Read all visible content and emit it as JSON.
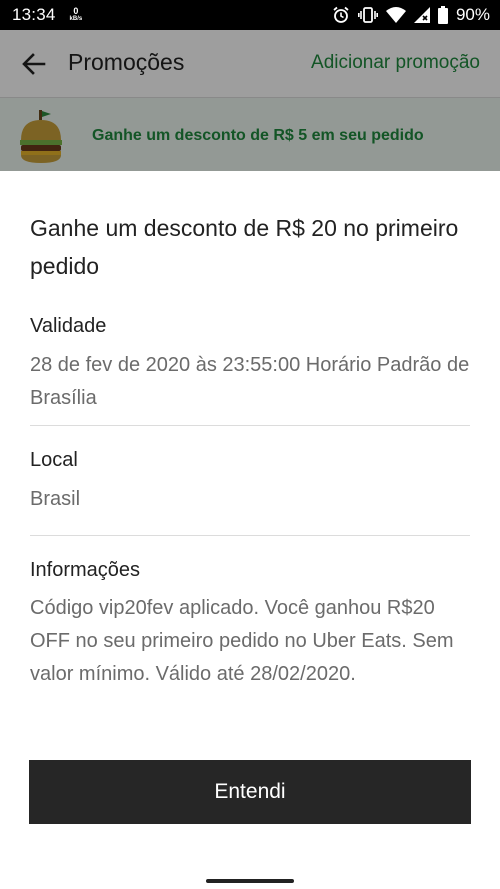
{
  "status_bar": {
    "time": "13:34",
    "net_speed_value": "0",
    "net_speed_unit": "kB/s",
    "battery": "90%",
    "icons": [
      "alarm-icon",
      "vibrate-icon",
      "wifi-icon",
      "signal-icon",
      "battery-icon"
    ]
  },
  "app_bar": {
    "title": "Promoções",
    "add_promo_label": "Adicionar promoção",
    "back_icon": "arrow-left-icon"
  },
  "promo_banner": {
    "text": "Ganhe um desconto de R$ 5 em seu pedido",
    "icon": "burger-icon"
  },
  "sheet": {
    "title": "Ganhe um desconto de R$ 20 no primeiro pedido",
    "validity": {
      "label": "Validade",
      "value": "28 de fev de 2020 às 23:55:00 Horário Padrão de Brasília"
    },
    "location": {
      "label": "Local",
      "value": "Brasil"
    },
    "info": {
      "label": "Informações",
      "value": "Código vip20fev aplicado. Você ganhou R$20 OFF no seu primeiro pedido no Uber Eats. Sem valor mínimo. Válido até 28/02/2020."
    },
    "button_label": "Entendi"
  },
  "colors": {
    "accent_green": "#1f8a3e",
    "button_dark": "#262626",
    "scrim": "rgba(0,0,0,0.38)"
  }
}
